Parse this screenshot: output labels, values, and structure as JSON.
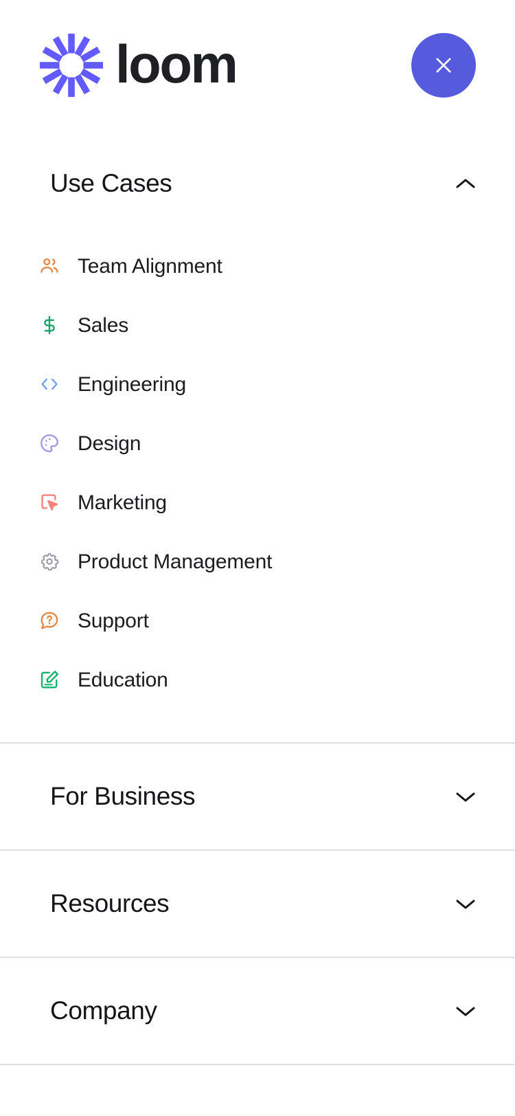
{
  "header": {
    "brand_name": "loom",
    "logo_icon": "loom-starburst-icon",
    "close_label": "×",
    "close_icon": "close-x-icon",
    "accent_color": "#565ADD"
  },
  "sections": [
    {
      "title": "Use Cases",
      "expanded": true,
      "chevron_icon": "chevron-up-icon",
      "items": [
        {
          "label": "Team Alignment",
          "icon": "users-icon",
          "color": "#E5833C"
        },
        {
          "label": "Sales",
          "icon": "dollar-sign-icon",
          "color": "#12A66A"
        },
        {
          "label": "Engineering",
          "icon": "code-brackets-icon",
          "color": "#6E9BF0"
        },
        {
          "label": "Design",
          "icon": "palette-icon",
          "color": "#9A95EE"
        },
        {
          "label": "Marketing",
          "icon": "cursor-click-icon",
          "color": "#F2837C"
        },
        {
          "label": "Product Management",
          "icon": "gear-icon",
          "color": "#9A9AA8"
        },
        {
          "label": "Support",
          "icon": "question-chat-icon",
          "color": "#E5833C"
        },
        {
          "label": "Education",
          "icon": "edit-square-icon",
          "color": "#12B36D"
        }
      ]
    },
    {
      "title": "For Business",
      "expanded": false,
      "chevron_icon": "chevron-down-icon",
      "items": []
    },
    {
      "title": "Resources",
      "expanded": false,
      "chevron_icon": "chevron-down-icon",
      "items": []
    },
    {
      "title": "Company",
      "expanded": false,
      "chevron_icon": "chevron-down-icon",
      "items": []
    }
  ]
}
